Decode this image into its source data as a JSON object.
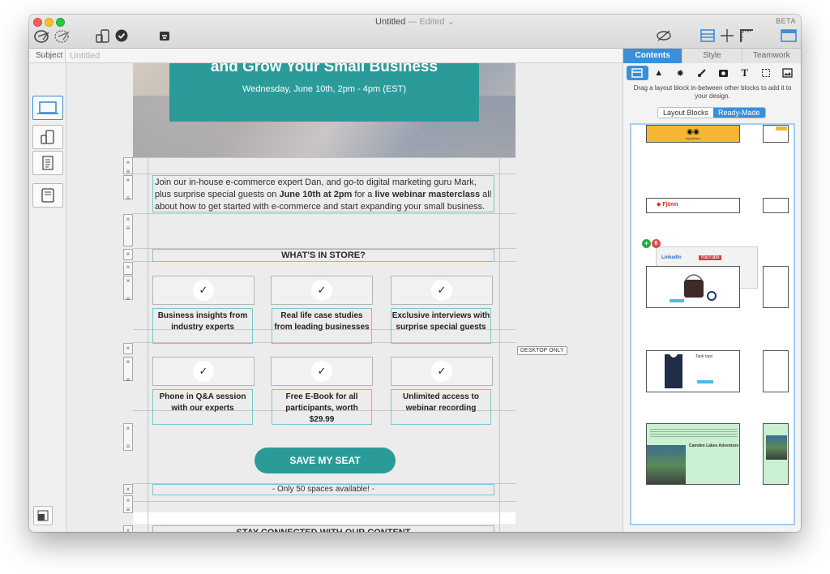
{
  "window": {
    "title": "Untitled",
    "title_suffix": "— Edited",
    "beta_label": "BETA"
  },
  "toolbar": {
    "left_icons": [
      "preview-icon",
      "send-test-icon",
      "mobile-send-icon",
      "check-icon",
      "bug-icon"
    ],
    "right_icons": [
      "hide-icon",
      "layout-icon",
      "move-icon",
      "ruler-icon",
      "panel-toggle-icon"
    ]
  },
  "subject": {
    "label": "Subject",
    "placeholder": "Untitled"
  },
  "devices": [
    "desktop",
    "mobile-tablet",
    "text",
    "inbox-preview"
  ],
  "email": {
    "hero": {
      "title": "and Grow Your Small Business",
      "date": "Wednesday, June 10th, 2pm - 4pm (EST)"
    },
    "intro": {
      "part1": "Join our in-house e-commerce expert Dan, and go-to digital marketing guru Mark, plus surprise special guests on ",
      "bold1": "June 10th at 2pm",
      "part2": " for a ",
      "bold2": "live webinar masterclass",
      "part3": " all about how to get started with e-commerce and start expanding your small business."
    },
    "store_heading": "WHAT'S IN STORE?",
    "check_glyph": "✓",
    "features_row1": [
      "Business insights from industry experts",
      "Real life case studies from leading businesses",
      "Exclusive interviews with surprise special guests"
    ],
    "features_row2": [
      "Phone in Q&A session with our experts",
      "Free E-Book for all participants, worth $29.99",
      "Unlimited access to webinar recording"
    ],
    "cta_label": "SAVE MY SEAT",
    "spaces_note": "- Only 50 spaces available! -",
    "connected_heading": "STAY CONNECTED WITH OUR CONTENT",
    "desktop_only_badge": "DESKTOP ONLY"
  },
  "panel": {
    "tabs": [
      "Contents",
      "Style",
      "Teamwork"
    ],
    "active_tab": "Contents",
    "tools": [
      "layout-block-icon",
      "triangle-icon",
      "burst-icon",
      "brush-icon",
      "camera-icon",
      "text-icon",
      "selection-icon",
      "image-icon"
    ],
    "hint": "Drag a layout block in-between other blocks to add it to your design.",
    "segments": [
      "Layout Blocks",
      "Ready-Made"
    ],
    "active_segment": "Ready-Made",
    "thumbs": {
      "tripadvisor_label": "tripadvisor",
      "fjonn_label": "Fjönn",
      "linkedin_label": "LinkedIn",
      "youtube_label": "YouTube",
      "product_heading": "Tank tops",
      "landscape_title": "Camden Lakes Adventure",
      "drag_badge_plus": "+",
      "drag_badge_count": "6"
    }
  },
  "colors": {
    "accent": "#3a8fd9",
    "teal": "#2b9b9a",
    "outline": "#7cc7cc"
  }
}
